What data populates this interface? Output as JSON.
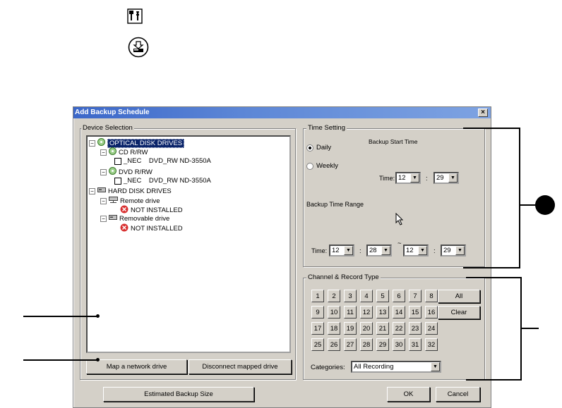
{
  "dialog": {
    "title": "Add Backup Schedule",
    "close_glyph": "×"
  },
  "device_selection": {
    "label": "Device Selection",
    "tree": [
      {
        "text": "OPTICAL DISK DRIVES",
        "icon": "optical-disk-icon"
      },
      {
        "text": "CD R/RW",
        "icon": "optical-disk-icon"
      },
      {
        "text": "_NEC    DVD_RW ND-3550A",
        "icon": "checkbox"
      },
      {
        "text": "DVD R/RW",
        "icon": "optical-disk-icon"
      },
      {
        "text": "_NEC    DVD_RW ND-3550A",
        "icon": "checkbox"
      },
      {
        "text": "HARD DISK DRIVES",
        "icon": "hard-disk-icon"
      },
      {
        "text": "Remote drive",
        "icon": "network-drive-icon"
      },
      {
        "text": "NOT INSTALLED",
        "icon": "error-icon"
      },
      {
        "text": "Removable drive",
        "icon": "hard-disk-icon"
      },
      {
        "text": "NOT INSTALLED",
        "icon": "error-icon"
      }
    ],
    "map_button": "Map a network drive",
    "disconnect_button": "Disconnect mapped drive"
  },
  "time_setting": {
    "label": "Time Setting",
    "start_label": "Backup Start Time",
    "daily": "Daily",
    "weekly": "Weekly",
    "time_label": "Time:",
    "start_hour": "12",
    "start_min": "29",
    "range_label": "Backup Time Range",
    "range_from_hour": "12",
    "range_from_min": "28",
    "range_to_hour": "12",
    "range_to_min": "29",
    "colon": ":",
    "tilde": "~"
  },
  "channel": {
    "label": "Channel & Record Type",
    "channels": [
      "1",
      "2",
      "3",
      "4",
      "5",
      "6",
      "7",
      "8",
      "9",
      "10",
      "11",
      "12",
      "13",
      "14",
      "15",
      "16",
      "17",
      "18",
      "19",
      "20",
      "21",
      "22",
      "23",
      "24",
      "25",
      "26",
      "27",
      "28",
      "29",
      "30",
      "31",
      "32"
    ],
    "all_button": "All",
    "clear_button": "Clear",
    "categories_label": "Categories:",
    "categories_value": "All Recording"
  },
  "footer": {
    "estimate_button": "Estimated Backup Size",
    "ok_button": "OK",
    "cancel_button": "Cancel"
  },
  "colors": {
    "dialog_bg": "#d4d0c8",
    "titlebar": "#3b67c9",
    "tree_selected": "#0a246a"
  }
}
